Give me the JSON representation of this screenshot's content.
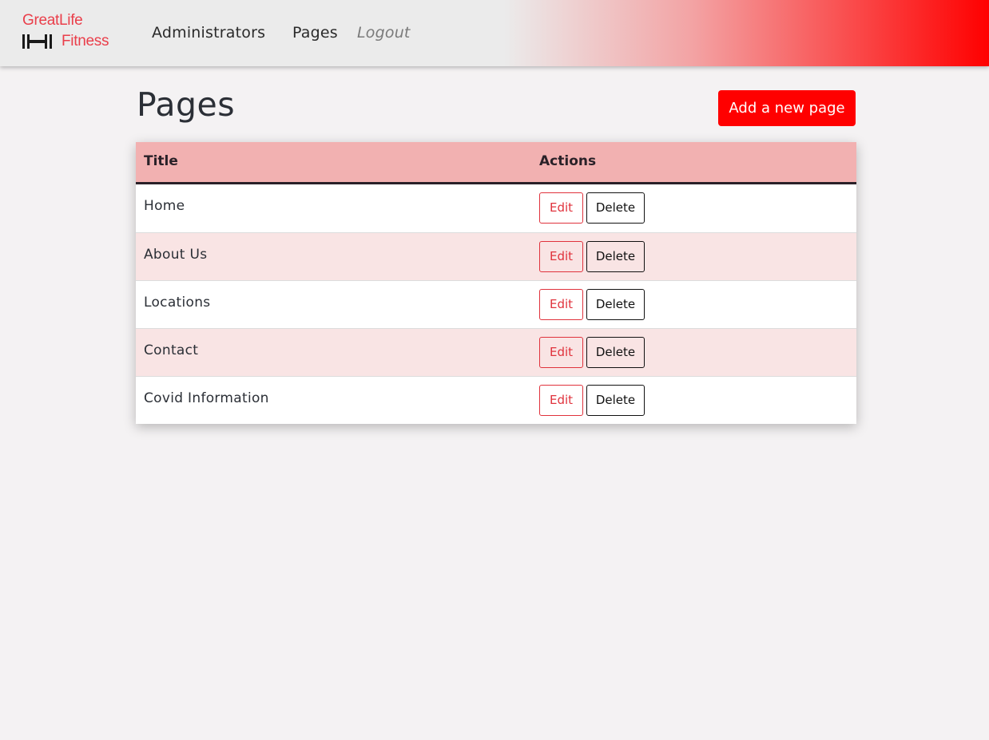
{
  "brand": {
    "line1": "GreatLife",
    "line2": "Fitness",
    "color": "#ea3e4a"
  },
  "nav": {
    "administrators": "Administrators",
    "pages": "Pages",
    "logout": "Logout"
  },
  "page": {
    "title": "Pages",
    "add_button": "Add a new page"
  },
  "table": {
    "headers": {
      "title": "Title",
      "actions": "Actions"
    },
    "rows": [
      {
        "title": "Home",
        "edit": "Edit",
        "delete": "Delete"
      },
      {
        "title": "About Us",
        "edit": "Edit",
        "delete": "Delete"
      },
      {
        "title": "Locations",
        "edit": "Edit",
        "delete": "Delete"
      },
      {
        "title": "Contact",
        "edit": "Edit",
        "delete": "Delete"
      },
      {
        "title": "Covid Information",
        "edit": "Edit",
        "delete": "Delete"
      }
    ]
  },
  "colors": {
    "accent": "#ff0000",
    "header_row": "#f2b1b1",
    "striped_row": "#f9e4e4",
    "edit_border": "#e0323c"
  }
}
